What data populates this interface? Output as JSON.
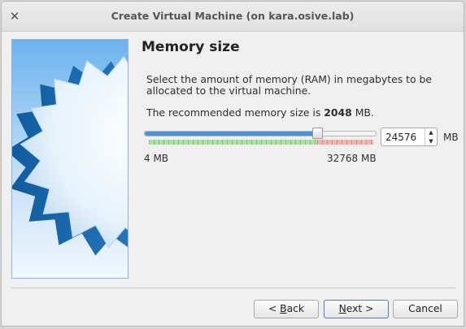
{
  "window": {
    "title": "Create Virtual Machine (on kara.osive.lab)",
    "close_icon": "close-icon"
  },
  "page": {
    "heading": "Memory size",
    "description": "Select the amount of memory (RAM) in megabytes to be allocated to the virtual machine.",
    "recommended_prefix": "The recommended memory size is ",
    "recommended_value": "2048",
    "recommended_suffix": " MB."
  },
  "memory": {
    "min_label": "4 MB",
    "max_label": "32768 MB",
    "min_value": 4,
    "max_value": 32768,
    "current_value": 24576,
    "input_value": "24576",
    "unit": "MB",
    "safe_fraction": 0.75
  },
  "buttons": {
    "back_prefix": "< ",
    "back_mnemonic": "B",
    "back_rest": "ack",
    "next_prefix": "",
    "next_mnemonic": "N",
    "next_rest": "ext >",
    "cancel": "Cancel"
  },
  "colors": {
    "accent": "#4a90d9",
    "safe": "#a9e2a1",
    "warning": "#f5b3b0"
  }
}
